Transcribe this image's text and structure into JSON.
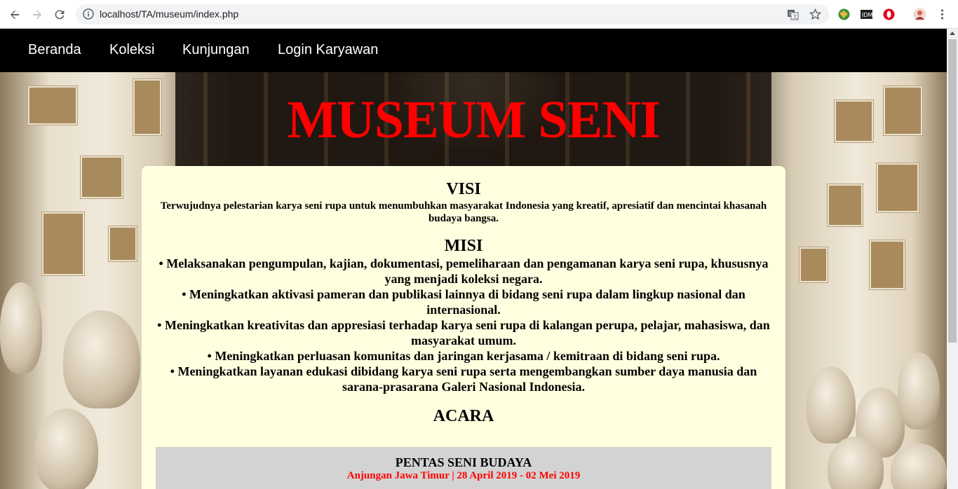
{
  "browser": {
    "url": "localhost/TA/museum/index.php"
  },
  "nav": {
    "items": [
      {
        "label": "Beranda"
      },
      {
        "label": "Koleksi"
      },
      {
        "label": "Kunjungan"
      },
      {
        "label": "Login Karyawan"
      }
    ]
  },
  "hero": {
    "title": "MUSEUM SENI"
  },
  "visi": {
    "heading": "VISI",
    "text": "Terwujudnya pelestarian karya seni rupa untuk menumbuhkan masyarakat Indonesia yang kreatif, apresiatif dan mencintai khasanah budaya bangsa."
  },
  "misi": {
    "heading": "MISI",
    "items": [
      "• Melaksanakan pengumpulan, kajian, dokumentasi, pemeliharaan dan pengamanan karya seni rupa, khususnya yang menjadi koleksi negara.",
      "• Meningkatkan aktivasi pameran dan publikasi lainnya di bidang seni rupa dalam lingkup nasional dan internasional.",
      "• Meningkatkan kreativitas dan appresiasi terhadap karya seni rupa di kalangan perupa, pelajar, mahasiswa, dan masyarakat umum.",
      "• Meningkatkan perluasan komunitas dan jaringan kerjasama / kemitraan di bidang seni rupa.",
      "• Meningkatkan layanan edukasi dibidang karya seni rupa serta mengembangkan sumber daya manusia dan sarana-prasarana Galeri Nasional Indonesia."
    ]
  },
  "acara": {
    "heading": "ACARA",
    "events": [
      {
        "name": "PENTAS SENI BUDAYA",
        "detail": "Anjungan Jawa Timur | 28 April 2019 - 02 Mei 2019"
      }
    ]
  },
  "colors": {
    "title": "#ff0000",
    "navbar": "#000000",
    "card": "#ffffe0",
    "event_bg": "#d3d3d3",
    "event_detail": "#ff0000"
  }
}
